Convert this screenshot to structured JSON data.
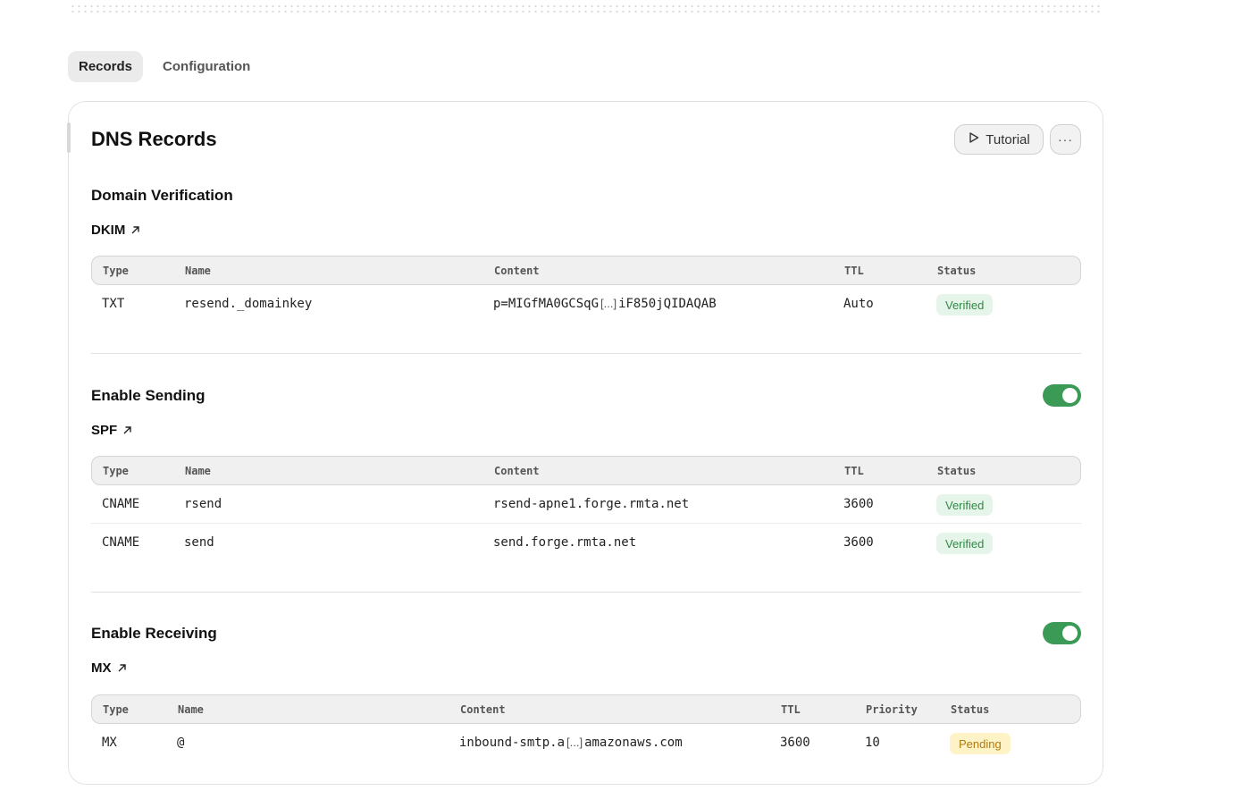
{
  "tabs": [
    {
      "label": "Records",
      "active": true
    },
    {
      "label": "Configuration",
      "active": false
    }
  ],
  "card": {
    "title": "DNS Records",
    "tutorial_label": "Tutorial",
    "more_label": "···"
  },
  "sections": {
    "verification": {
      "title": "Domain Verification",
      "record_label": "DKIM",
      "columns": [
        "Type",
        "Name",
        "Content",
        "TTL",
        "Status"
      ],
      "rows": [
        {
          "type": "TXT",
          "name": "resend._domainkey",
          "content_start": "p=MIGfMA0GCSqG",
          "trunc": "[...]",
          "content_end": "iF850jQIDAQAB",
          "ttl": "Auto",
          "status": "Verified"
        }
      ]
    },
    "sending": {
      "title": "Enable Sending",
      "toggle_on": true,
      "record_label": "SPF",
      "columns": [
        "Type",
        "Name",
        "Content",
        "TTL",
        "Status"
      ],
      "rows": [
        {
          "type": "CNAME",
          "name": "rsend",
          "content": "rsend-apne1.forge.rmta.net",
          "ttl": "3600",
          "status": "Verified"
        },
        {
          "type": "CNAME",
          "name": "send",
          "content": "send.forge.rmta.net",
          "ttl": "3600",
          "status": "Verified"
        }
      ]
    },
    "receiving": {
      "title": "Enable Receiving",
      "toggle_on": true,
      "record_label": "MX",
      "columns": [
        "Type",
        "Name",
        "Content",
        "TTL",
        "Priority",
        "Status"
      ],
      "rows": [
        {
          "type": "MX",
          "name": "@",
          "content_start": "inbound-smtp.a",
          "trunc": "[...]",
          "content_end": "amazonaws.com",
          "ttl": "3600",
          "priority": "10",
          "status": "Pending"
        }
      ]
    }
  },
  "colors": {
    "toggle_on": "#3a9a56",
    "verified_bg": "#e6f5e9",
    "verified_text": "#2e8a45",
    "pending_bg": "#fdf3c7",
    "pending_text": "#b07a10"
  }
}
